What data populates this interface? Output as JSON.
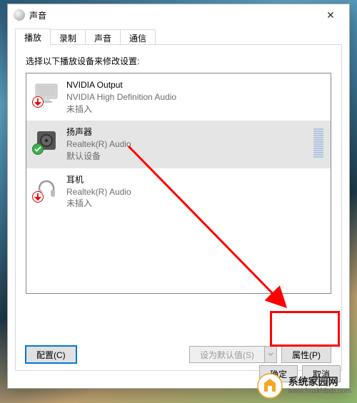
{
  "window": {
    "title": "声音",
    "close_label": "✕"
  },
  "tabs": [
    {
      "label": "播放",
      "active": true
    },
    {
      "label": "录制",
      "active": false
    },
    {
      "label": "声音",
      "active": false
    },
    {
      "label": "通信",
      "active": false
    }
  ],
  "instruction": "选择以下播放设备来修改设置:",
  "devices": [
    {
      "name": "NVIDIA Output",
      "sub": "NVIDIA High Definition Audio",
      "status": "未插入",
      "icon": "monitor",
      "badge": "down-red",
      "selected": false,
      "meter": false
    },
    {
      "name": "扬声器",
      "sub": "Realtek(R) Audio",
      "status": "默认设备",
      "icon": "speaker",
      "badge": "check-green",
      "selected": true,
      "meter": true
    },
    {
      "name": "耳机",
      "sub": "Realtek(R) Audio",
      "status": "未插入",
      "icon": "headphones",
      "badge": "down-red",
      "selected": false,
      "meter": false
    }
  ],
  "panel_buttons": {
    "configure": "配置(C)",
    "set_default": "设为默认值(S)",
    "properties": "属性(P)"
  },
  "footer": {
    "ok": "确定",
    "cancel": "取消"
  },
  "watermark": {
    "name": "系统家园网",
    "url": "www.hnzkhbsb.com"
  },
  "annotation": {
    "highlight_target": "properties-button",
    "arrow_from": "device-list",
    "arrow_to": "properties-button",
    "color": "#ff0000"
  }
}
